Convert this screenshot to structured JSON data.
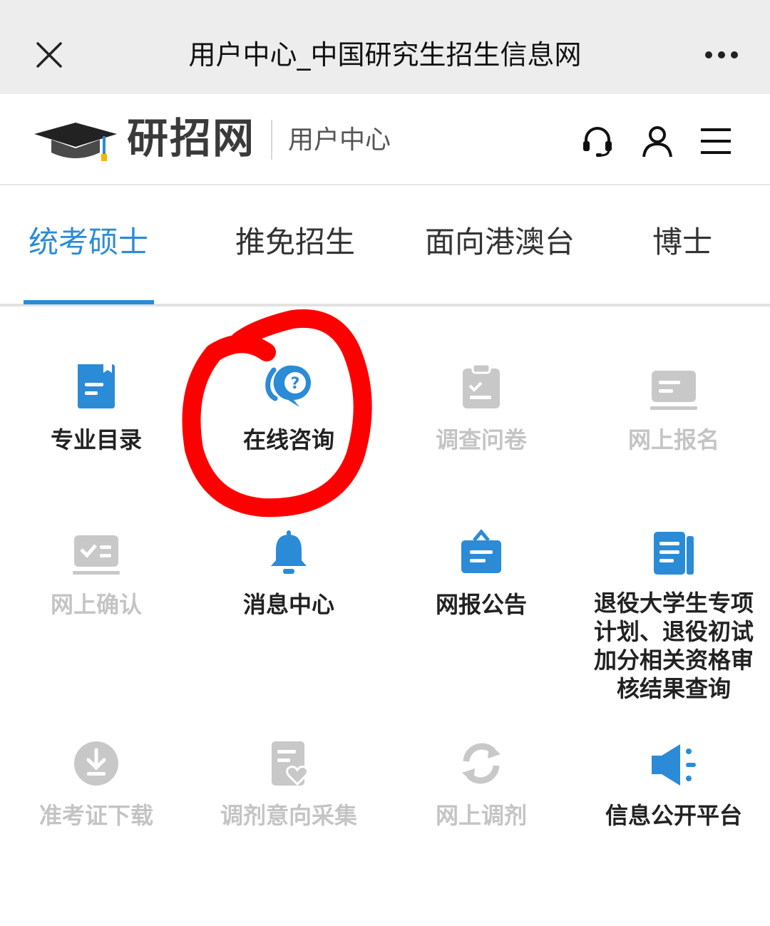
{
  "topbar": {
    "title": "用户中心_中国研究生招生信息网",
    "close_icon": "close-icon",
    "more_icon": "more-icon"
  },
  "header": {
    "logo_text": "研招网",
    "subtitle": "用户中心",
    "icons": [
      "headset-icon",
      "user-icon",
      "menu-icon"
    ]
  },
  "tabs": [
    {
      "label": "统考硕士",
      "active": true
    },
    {
      "label": "推免招生",
      "active": false
    },
    {
      "label": "面向港澳台",
      "active": false
    },
    {
      "label": "博士",
      "active": false
    }
  ],
  "grid": [
    {
      "label": "专业目录",
      "icon": "catalog-icon",
      "enabled": true
    },
    {
      "label": "在线咨询",
      "icon": "consult-chat-icon",
      "enabled": true
    },
    {
      "label": "调查问卷",
      "icon": "clipboard-icon",
      "enabled": false
    },
    {
      "label": "网上报名",
      "icon": "register-card-icon",
      "enabled": false
    },
    {
      "label": "网上确认",
      "icon": "confirm-card-icon",
      "enabled": false
    },
    {
      "label": "消息中心",
      "icon": "bell-icon",
      "enabled": true
    },
    {
      "label": "网报公告",
      "icon": "briefcase-icon",
      "enabled": true
    },
    {
      "label": "退役大学生专项计划、退役初试加分相关资格审核结果查询",
      "label_lines": [
        "退役大学生专项",
        "计划、退役初试",
        "加分相关资格审",
        "核结果查询"
      ],
      "icon": "document-icon",
      "enabled": true
    },
    {
      "label": "准考证下载",
      "icon": "download-icon",
      "enabled": false
    },
    {
      "label": "调剂意向采集",
      "icon": "heart-doc-icon",
      "enabled": false
    },
    {
      "label": "网上调剂",
      "icon": "refresh-icon",
      "enabled": false
    },
    {
      "label": "信息公开平台",
      "icon": "megaphone-icon",
      "enabled": true
    }
  ],
  "colors": {
    "accent": "#2b8bd6",
    "disabled": "#c4c4c4",
    "annotation": "#ff0000"
  }
}
